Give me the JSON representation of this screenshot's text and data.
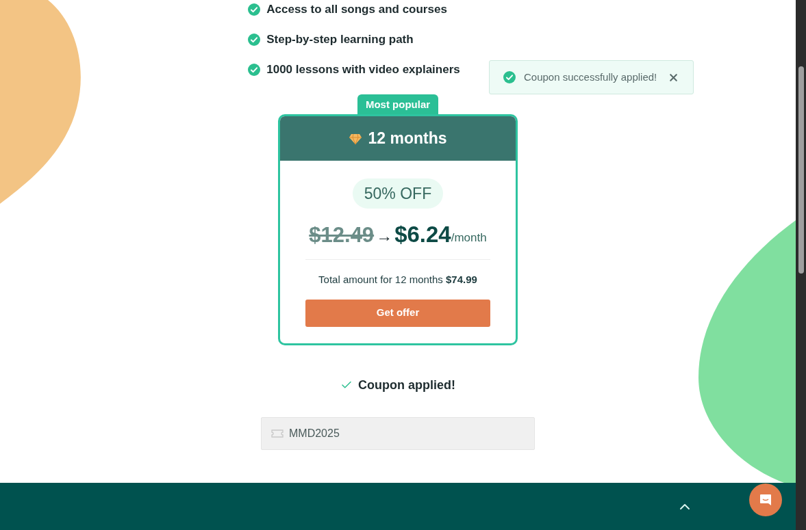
{
  "features": [
    {
      "text": "Access to all songs and courses"
    },
    {
      "text": "Step-by-step learning path"
    },
    {
      "text": "1000 lessons with video explainers"
    }
  ],
  "toast": {
    "message": "Coupon successfully applied!"
  },
  "plan": {
    "badge": "Most popular",
    "title": "12 months",
    "discount": "50% OFF",
    "old_price": "$12.49",
    "arrow": "→",
    "price": "$6.24",
    "unit": "/month",
    "total": "Total amount for 12 months **$74.99**",
    "button": "Get offer"
  },
  "coupon_status": "Coupon applied!",
  "coupon_field": {
    "value": "MMD2025"
  }
}
